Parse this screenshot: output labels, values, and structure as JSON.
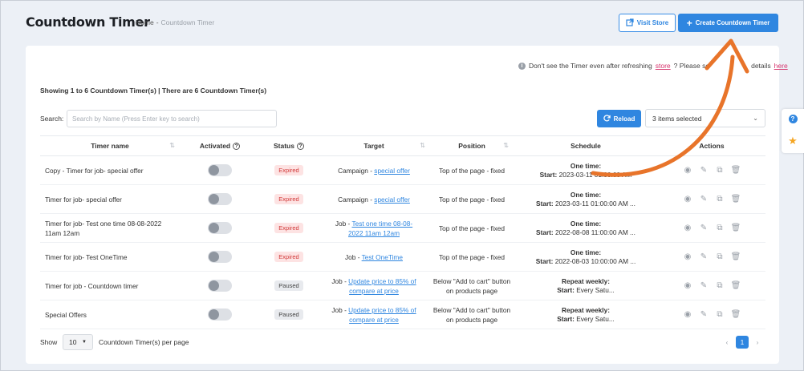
{
  "header": {
    "title": "Countdown Timer",
    "breadcrumb": {
      "home": "Home",
      "sep": "-",
      "current": "Countdown Timer"
    },
    "visit_store_label": "Visit Store",
    "create_label": "Create Countdown Timer"
  },
  "notice": {
    "prefix": "Don't see the Timer even after refreshing",
    "store_link": "store",
    "middle": "? Please se",
    "middle_tail": "details",
    "here_link": "here"
  },
  "showing": "Showing 1 to 6 Countdown Timer(s) | There are 6 Countdown Timer(s)",
  "search": {
    "label": "Search:",
    "placeholder": "Search by Name (Press Enter key to search)"
  },
  "reload_label": "Reload",
  "items_selected": "3 items selected",
  "columns": {
    "name": "Timer name",
    "activated": "Activated",
    "status": "Status",
    "target": "Target",
    "position": "Position",
    "schedule": "Schedule",
    "actions": "Actions"
  },
  "rows": [
    {
      "name": "Copy - Timer for job- special offer",
      "status": "Expired",
      "target_prefix": "Campaign - ",
      "target_link": "special offer",
      "position": "Top of the page - fixed",
      "sched_title": "One time:",
      "sched_label": "Start:",
      "sched_value": "2023-03-11 01:00:00 AM"
    },
    {
      "name": "Timer for job- special offer",
      "status": "Expired",
      "target_prefix": "Campaign - ",
      "target_link": "special offer",
      "position": "Top of the page - fixed",
      "sched_title": "One time:",
      "sched_label": "Start:",
      "sched_value": "2023-03-11 01:00:00 AM ..."
    },
    {
      "name": "Timer for job- Test one time 08-08-2022 11am 12am",
      "status": "Expired",
      "target_prefix": "Job - ",
      "target_link": "Test one time 08-08-2022 11am 12am",
      "position": "Top of the page - fixed",
      "sched_title": "One time:",
      "sched_label": "Start:",
      "sched_value": "2022-08-08 11:00:00 AM ..."
    },
    {
      "name": "Timer for job- Test OneTime",
      "status": "Expired",
      "target_prefix": "Job - ",
      "target_link": "Test OneTime",
      "position": "Top of the page - fixed",
      "sched_title": "One time:",
      "sched_label": "Start:",
      "sched_value": "2022-08-03 10:00:00 AM ..."
    },
    {
      "name": "Timer for job - Countdown timer",
      "status": "Paused",
      "target_prefix": "Job - ",
      "target_link": "Update price to 85% of compare at price",
      "position": "Below \"Add to cart\" button on products page",
      "sched_title": "Repeat weekly:",
      "sched_label": "Start:",
      "sched_value": "Every Satu..."
    },
    {
      "name": "Special Offers",
      "status": "Paused",
      "target_prefix": "Job - ",
      "target_link": "Update price to 85% of compare at price",
      "position": "Below \"Add to cart\" button on products page",
      "sched_title": "Repeat weekly:",
      "sched_label": "Start:",
      "sched_value": "Every Satu..."
    }
  ],
  "footer": {
    "show": "Show",
    "per_page_value": "10",
    "per_page_text": "Countdown Timer(s) per page"
  },
  "pagination": {
    "prev": "‹",
    "current": "1",
    "next": "›"
  },
  "colors": {
    "accent": "#2f86e0",
    "expired": "#d23b3b",
    "annotation_arrow": "#e8742a"
  }
}
